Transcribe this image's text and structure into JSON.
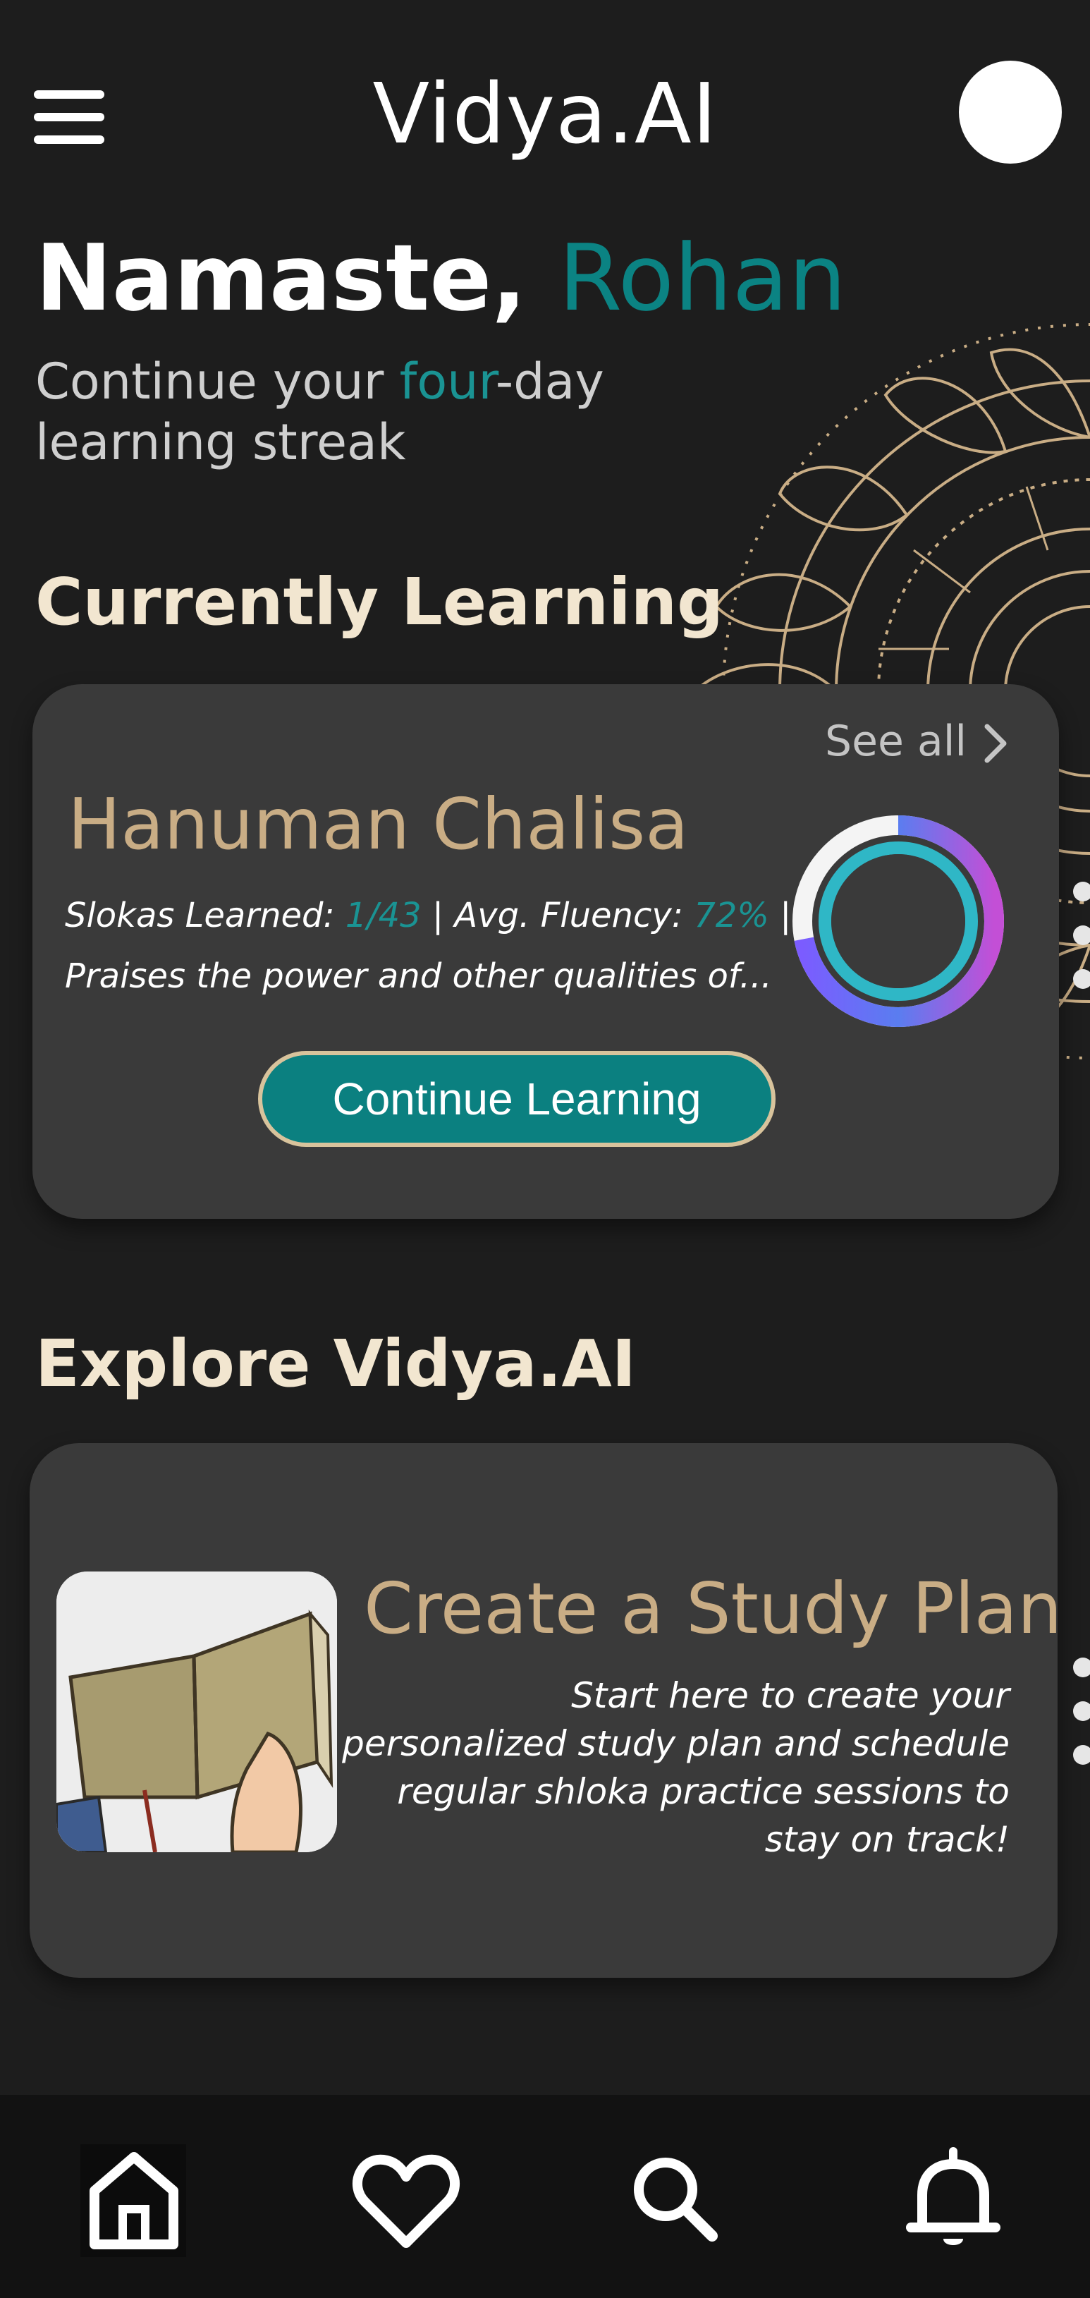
{
  "header": {
    "title": "Vidya.AI",
    "menu_icon": "hamburger-menu-icon",
    "avatar": "profile-avatar"
  },
  "greeting": {
    "prefix": "Namaste,",
    "name": "Rohan",
    "streak_before": "Continue your ",
    "streak_highlight": "four",
    "streak_after": "-day",
    "streak_line2": "learning streak"
  },
  "current": {
    "section_title": "Currently Learning",
    "see_all": "See all",
    "course_title": "Hanuman Chalisa",
    "slokas_label": "Slokas Learned: ",
    "slokas_value": "1/43",
    "fluency_label": " | Avg. Fluency: ",
    "fluency_value": "72%",
    "fluency_suffix": " |",
    "description": "Praises the power and other qualities of...",
    "button_label": "Continue Learning",
    "progress_fraction": 0.72
  },
  "explore": {
    "section_title": "Explore Vidya.AI",
    "card_title": "Create a Study Plan",
    "card_description": "Start here to create your personalized study plan and schedule regular shloka practice sessions to stay on track!",
    "image_icon": "open-book-image"
  },
  "nav": {
    "items": [
      {
        "icon": "home-icon"
      },
      {
        "icon": "heart-icon"
      },
      {
        "icon": "search-icon"
      },
      {
        "icon": "bell-icon"
      }
    ]
  },
  "colors": {
    "background": "#1d1d1d",
    "card": "#3a3a3a",
    "teal_accent": "#0b8383",
    "gold": "#c9ad85",
    "cream": "#f2e6d0"
  }
}
